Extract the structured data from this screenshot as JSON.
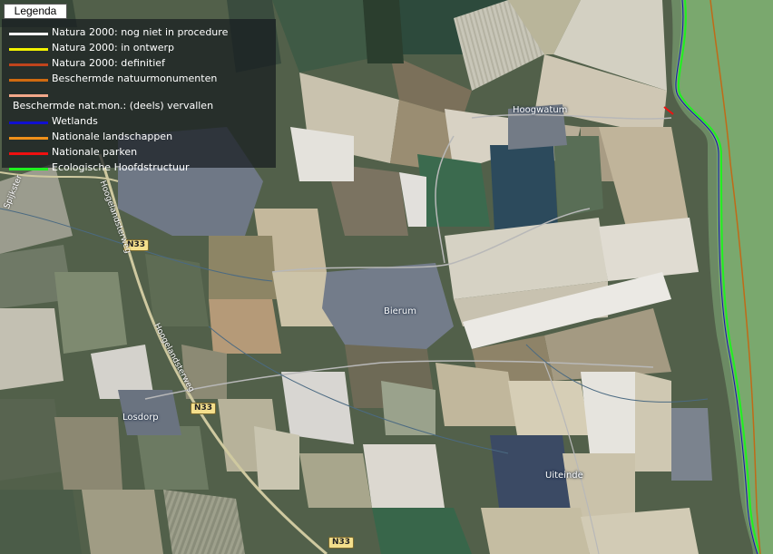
{
  "legend": {
    "button_label": "Legenda",
    "items": [
      {
        "label": "Natura 2000: nog niet in procedure",
        "color": "#ffffff"
      },
      {
        "label": "Natura 2000: in ontwerp",
        "color": "#f2f200"
      },
      {
        "label": "Natura 2000: definitief",
        "color": "#c0441c"
      },
      {
        "label": "Beschermde natuurmonumenten",
        "color": "#d06a10"
      },
      {
        "label": "",
        "color": "#f4a88a"
      },
      {
        "label": "Beschermde nat.mon.: (deels) vervallen",
        "color": ""
      },
      {
        "label": "Wetlands",
        "color": "#1010d0"
      },
      {
        "label": "Nationale landschappen",
        "color": "#f0901a"
      },
      {
        "label": "Nationale parken",
        "color": "#f01010"
      },
      {
        "label": "Ecologische Hoofdstructuur",
        "color": "#20f020"
      }
    ]
  },
  "places": {
    "hoogwatum": "Hoogwatum",
    "bierum": "Bierum",
    "losdorp": "Losdorp",
    "uiteinde": "Uiteinde"
  },
  "roads": {
    "n33_shield": "N33",
    "hoogelandsterweg": "Hoogelandsterweg",
    "spijkster": "Spijkster"
  },
  "colors": {
    "sea": "#7aa86e",
    "ehs_line": "#20f020",
    "landscape_line": "#c06a18"
  }
}
